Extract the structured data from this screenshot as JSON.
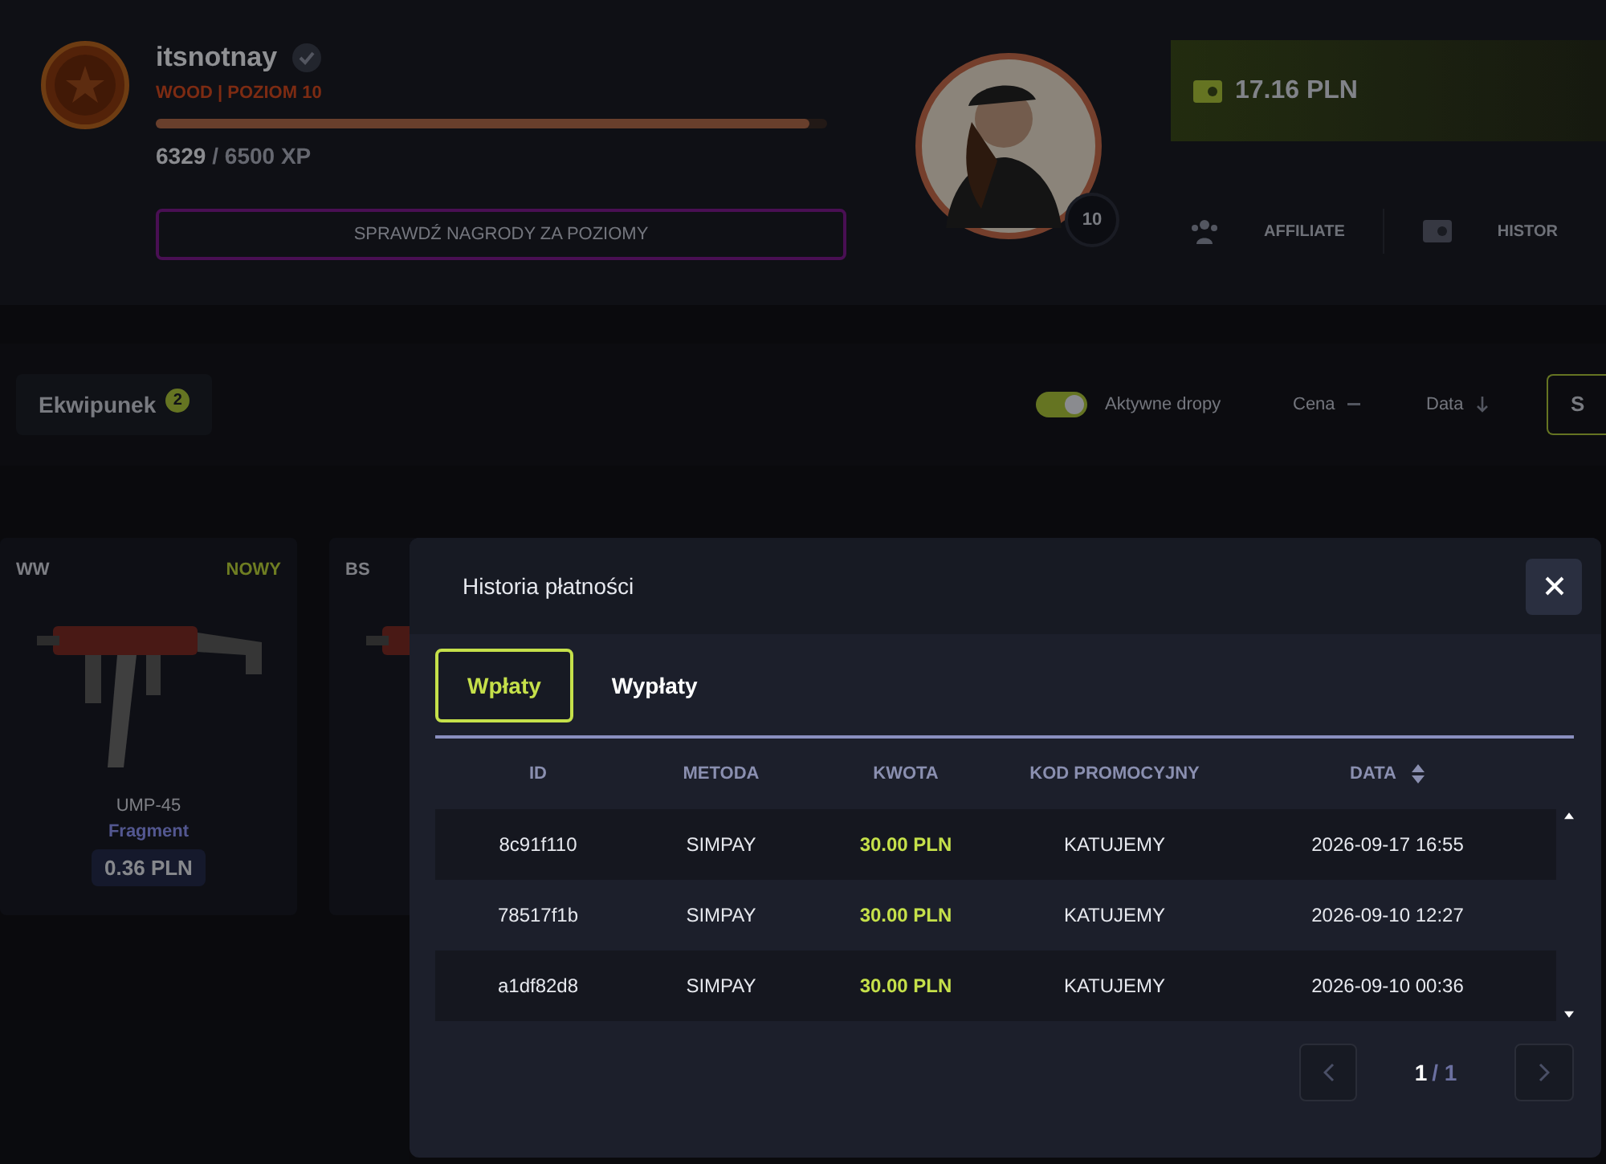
{
  "profile": {
    "username": "itsnotnay",
    "verified": true,
    "rank": "WOOD | POZIOM 10",
    "xp": {
      "level": 0.974,
      "current": "6329",
      "total": "/ 6500 XP"
    },
    "rewards_button": "SPRAWDŹ NAGRODY ZA POZIOMY",
    "avatar_level": "10"
  },
  "balance": {
    "amount": "17.16 PLN"
  },
  "nav": [
    {
      "kind": "people",
      "label": "AFFILIATE"
    },
    {
      "kind": "wallet",
      "label": "HISTOR"
    }
  ],
  "toolbar": {
    "inventory_tab": {
      "label": "Ekwipunek",
      "count": "2"
    },
    "active_drops": {
      "label": "Aktywne dropy",
      "on": true
    },
    "sorts": [
      {
        "label": "Cena",
        "kind": "dash"
      },
      {
        "label": "Data",
        "kind": "arrow"
      }
    ],
    "button": "S"
  },
  "items": [
    {
      "condition": "WW",
      "tag": "NOWY",
      "name": "UMP-45",
      "skin": "Fragment",
      "price": "0.36 PLN"
    },
    {
      "condition": "BS"
    }
  ],
  "modal": {
    "title": "Historia płatności",
    "tabs": [
      {
        "label": "Wpłaty",
        "selected": true
      },
      {
        "label": "Wypłaty",
        "selected": false
      }
    ],
    "columns": [
      {
        "label": "ID",
        "sortable": false
      },
      {
        "label": "METODA",
        "sortable": false
      },
      {
        "label": "KWOTA",
        "sortable": false
      },
      {
        "label": "KOD PROMOCYJNY",
        "sortable": false
      },
      {
        "label": "DATA",
        "sortable": true
      }
    ],
    "rows": [
      [
        "8c91f110",
        "SIMPAY",
        "30.00 PLN",
        "KATUJEMY",
        "2026-09-17 16:55"
      ],
      [
        "78517f1b",
        "SIMPAY",
        "30.00 PLN",
        "KATUJEMY",
        "2026-09-10 12:27"
      ],
      [
        "a1df82d8",
        "SIMPAY",
        "30.00 PLN",
        "KATUJEMY",
        "2026-09-10 00:36"
      ]
    ],
    "pagination": {
      "current": "1",
      "total": "/ 1"
    }
  }
}
